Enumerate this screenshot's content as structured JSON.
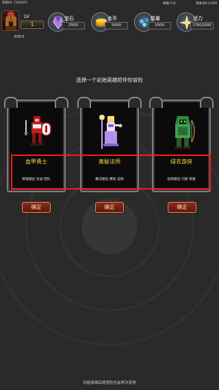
{
  "status": {
    "player_id": "玩家ID: 7103025",
    "mail": "邮箱:132",
    "version": "版本号0.0.009"
  },
  "header": {
    "lv_label": "LV",
    "lv_value": "1",
    "exp_label": "EXP:0",
    "resources": [
      {
        "label": "宝石",
        "value": "2500",
        "icon": "gem-icon",
        "color": "#a46bd8"
      },
      {
        "label": "金币",
        "value": "5000",
        "icon": "coin-icon",
        "color": "#f2b51a"
      },
      {
        "label": "能量",
        "value": "2000",
        "icon": "energy-icon",
        "color": "#4fb6f0"
      },
      {
        "label": "活力",
        "value": "1700/1000",
        "icon": "vigor-icon",
        "color": "#e8d070"
      }
    ]
  },
  "prompt": "选择一个初始英雄陪伴你冒险",
  "heroes": [
    {
      "name": "血甲勇士",
      "desc": "物理输出 近战 团队",
      "confirm": "确定"
    },
    {
      "name": "奥秘法师",
      "desc": "魔法输出 爆发 远程",
      "confirm": "确定"
    },
    {
      "name": "绿衣游侠",
      "desc": "远程输出 闪避 快速",
      "confirm": "确定"
    }
  ],
  "footer_note": "初始英雄后续冒险也会再次获得",
  "colors": {
    "highlight": "#ff1a1a",
    "hero_name": "#ffd84a",
    "button": "#7a2219"
  }
}
